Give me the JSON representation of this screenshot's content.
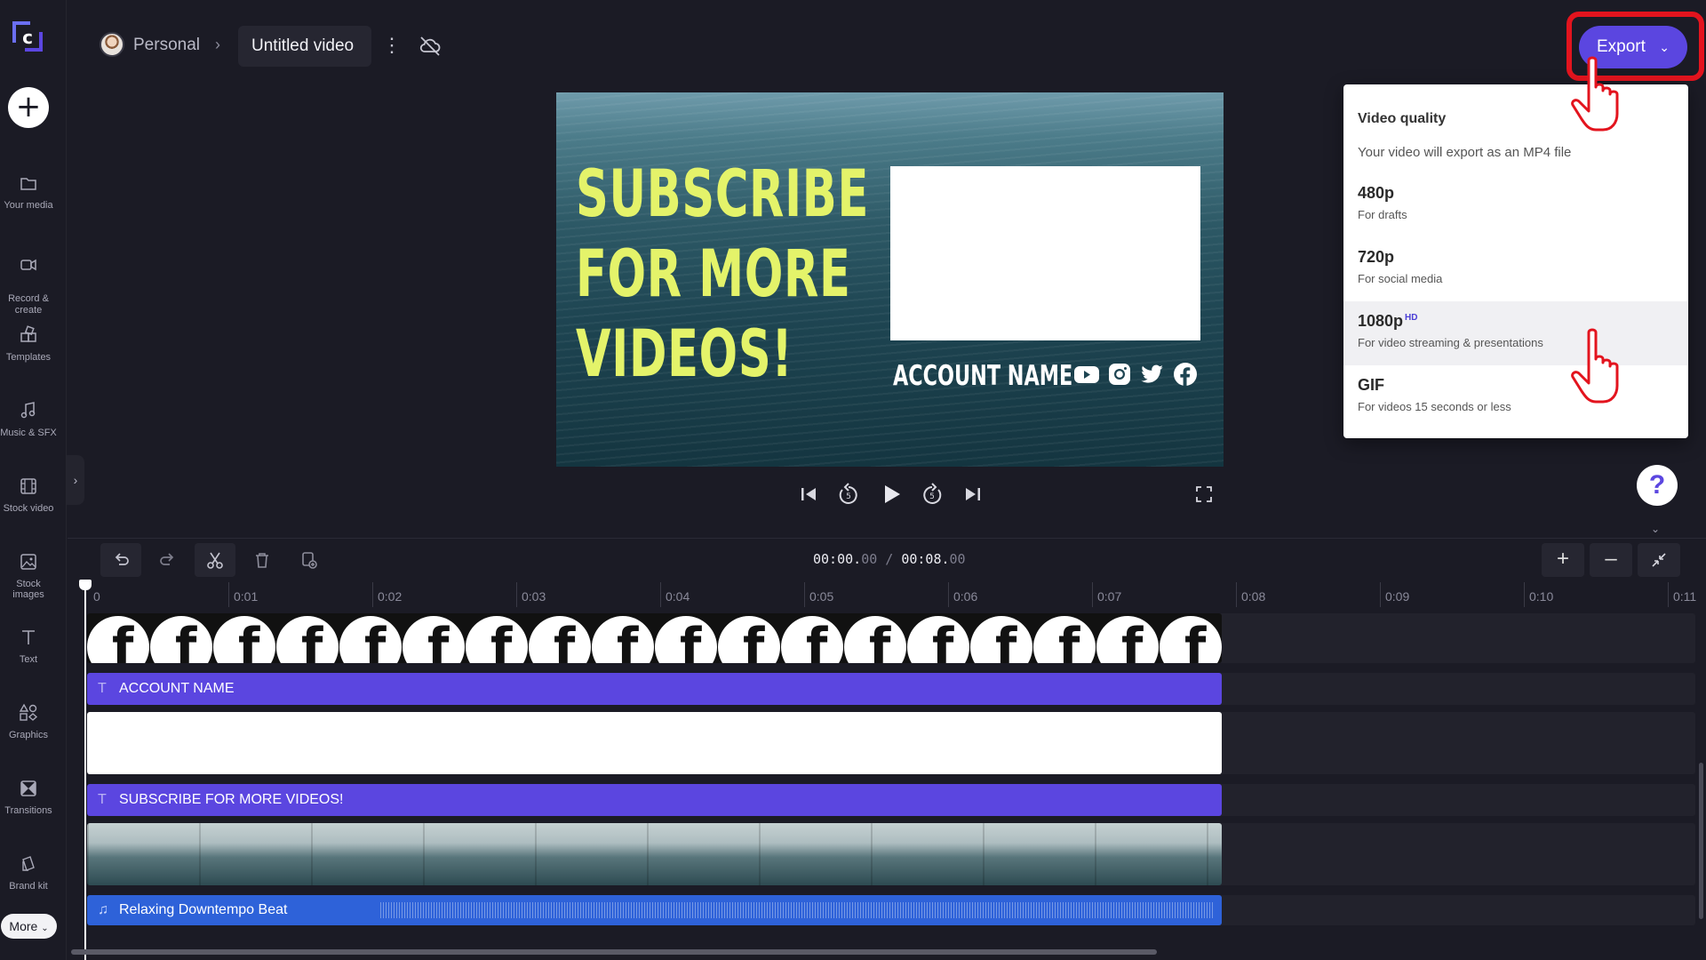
{
  "header": {
    "breadcrumb_workspace": "Personal",
    "breadcrumb_separator": "›",
    "project_title": "Untitled video",
    "export_label": "Export"
  },
  "sidebar": {
    "add_label": "+",
    "items": [
      {
        "label": "Your media",
        "icon": "folder-icon"
      },
      {
        "label": "Record &\ncreate",
        "icon": "camera-icon"
      },
      {
        "label": "Templates",
        "icon": "templates-icon"
      },
      {
        "label": "Music & SFX",
        "icon": "music-icon"
      },
      {
        "label": "Stock video",
        "icon": "film-icon"
      },
      {
        "label": "Stock images",
        "icon": "image-icon"
      },
      {
        "label": "Text",
        "icon": "text-icon"
      },
      {
        "label": "Graphics",
        "icon": "shapes-icon"
      },
      {
        "label": "Transitions",
        "icon": "transitions-icon"
      },
      {
        "label": "Brand kit",
        "icon": "brand-kit-icon"
      }
    ],
    "more_label": "More"
  },
  "export_menu": {
    "heading": "Video quality",
    "description": "Your video will export as an MP4 file",
    "options": [
      {
        "quality": "480p",
        "subtitle": "For drafts",
        "badge": ""
      },
      {
        "quality": "720p",
        "subtitle": "For social media",
        "badge": ""
      },
      {
        "quality": "1080p",
        "subtitle": "For video streaming & presentations",
        "badge": "HD"
      },
      {
        "quality": "GIF",
        "subtitle": "For videos 15 seconds or less",
        "badge": ""
      }
    ],
    "selected": "1080p"
  },
  "preview": {
    "headline_line1": "SUBSCRIBE",
    "headline_line2": "FOR MORE",
    "headline_line3": "VIDEOS!",
    "account_name": "ACCOUNT NAME",
    "social_icons": [
      "youtube-icon",
      "instagram-icon",
      "twitter-icon",
      "facebook-icon"
    ],
    "headline_color": "#e4f36a"
  },
  "timeline": {
    "current_time_main": "00:00.",
    "current_time_frac": "00",
    "separator": " / ",
    "total_time_main": "00:08.",
    "total_time_frac": "00",
    "ruler_ticks": [
      "0",
      "0:01",
      "0:02",
      "0:03",
      "0:04",
      "0:05",
      "0:06",
      "0:07",
      "0:08",
      "0:09",
      "0:10",
      "0:11"
    ],
    "tracks": {
      "text_account": "ACCOUNT NAME",
      "text_subscribe": "SUBSCRIBE FOR MORE VIDEOS!",
      "audio": "Relaxing Downtempo Beat"
    }
  },
  "help_label": "?",
  "colors": {
    "accent": "#5b46e0",
    "audio_track": "#2e62d9",
    "highlight": "#e3141e",
    "background": "#1b1b25"
  }
}
